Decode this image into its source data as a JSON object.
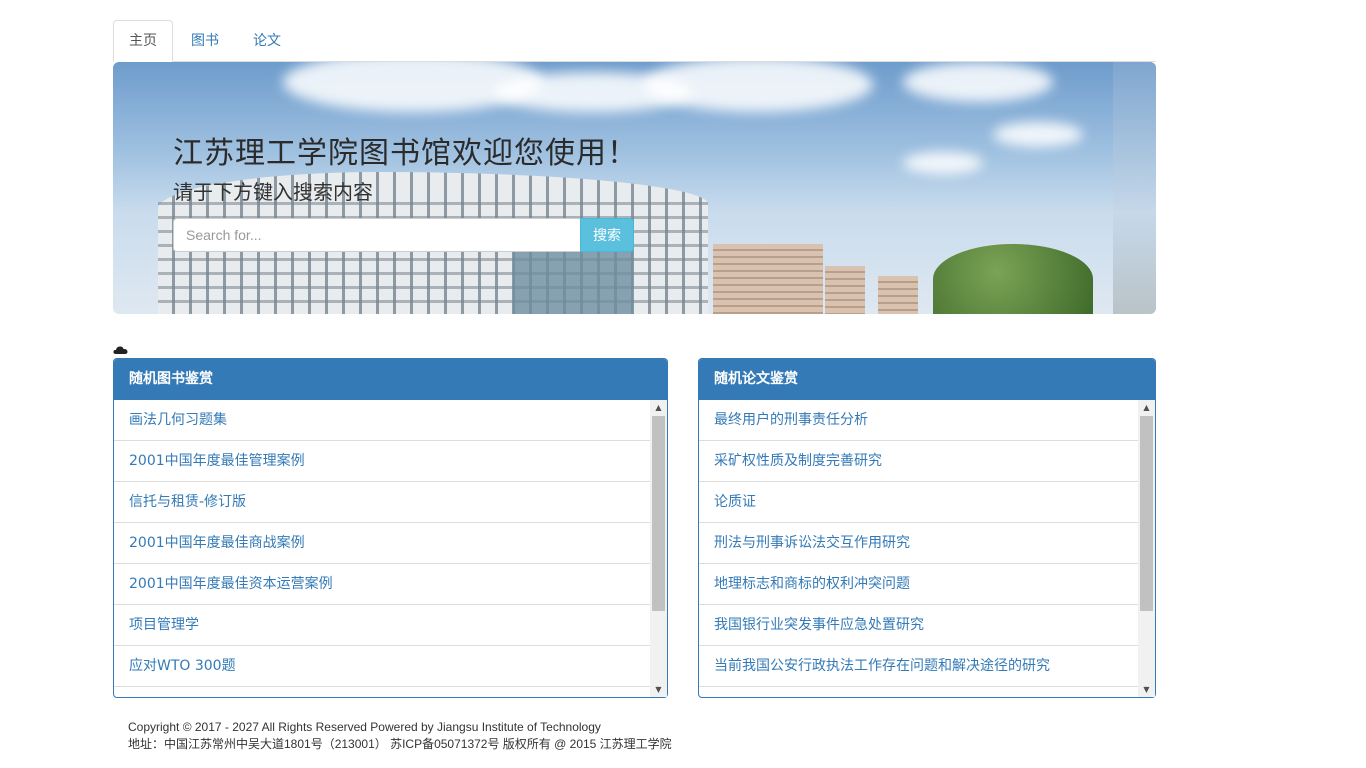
{
  "tabs": [
    {
      "label": "主页",
      "active": true
    },
    {
      "label": "图书",
      "active": false
    },
    {
      "label": "论文",
      "active": false
    }
  ],
  "banner": {
    "title": "江苏理工学院图书馆欢迎您使用！",
    "subtitle": "请于下方键入搜索内容",
    "search": {
      "placeholder": "Search for...",
      "value": "",
      "button_label": "搜索"
    }
  },
  "weather_icon": "cloud-icon",
  "books_panel": {
    "heading": "随机图书鉴赏",
    "items": [
      "画法几何习题集",
      "2001中国年度最佳管理案例",
      "信托与租赁-修订版",
      "2001中国年度最佳商战案例",
      "2001中国年度最佳资本运营案例",
      "项目管理学",
      "应对WTO 300题"
    ]
  },
  "papers_panel": {
    "heading": "随机论文鉴赏",
    "items": [
      "最终用户的刑事责任分析",
      "采矿权性质及制度完善研究",
      "论质证",
      "刑法与刑事诉讼法交互作用研究",
      "地理标志和商标的权利冲突问题",
      "我国银行业突发事件应急处置研究",
      "当前我国公安行政执法工作存在问题和解决途径的研究"
    ]
  },
  "footer": {
    "line1": "Copyright © 2017 - 2027 All Rights Reserved Powered by Jiangsu Institute of Technology",
    "line2": "地址：中国江苏常州中吴大道1801号（213001） 苏ICP备05071372号  版权所有 @ 2015 江苏理工学院"
  },
  "colors": {
    "primary": "#337ab7",
    "info": "#5bc0de",
    "border": "#dddddd"
  }
}
